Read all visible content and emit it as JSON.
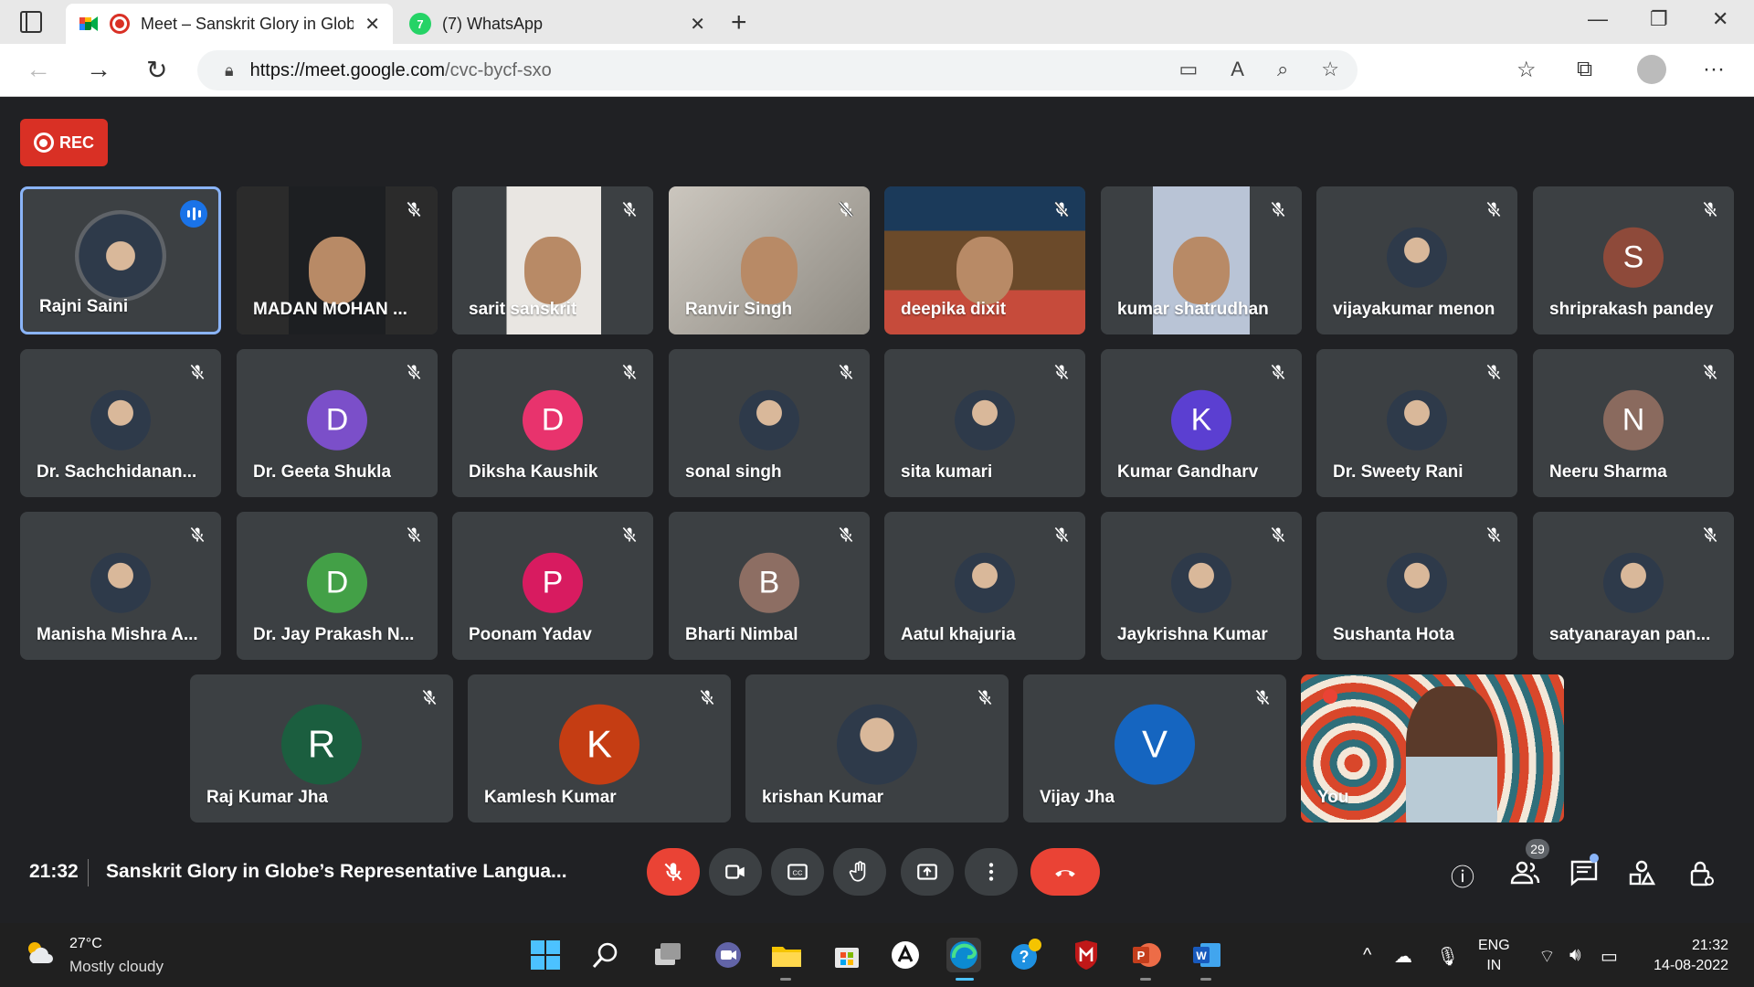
{
  "browser": {
    "tabs": [
      {
        "title": "Meet – Sanskrit Glory in Globe’s Representative Language",
        "active": true
      },
      {
        "title": "(7) WhatsApp",
        "active": false,
        "badge": "7"
      }
    ],
    "url_host": "https://meet.google.com",
    "url_path": "/cvc-bycf-sxo"
  },
  "meet": {
    "rec_label": "REC",
    "time": "21:32",
    "title": "Sanskrit Glory in Globe’s Representative Langua...",
    "participant_count": "29",
    "colors": {
      "bg": "#202124",
      "tile": "#3c4043",
      "red": "#ea4335",
      "speaking_border": "#8ab4f8"
    },
    "participants": [
      {
        "name": "Rajni Saini",
        "kind": "photo",
        "speaking": true
      },
      {
        "name": "MADAN MOHAN ...",
        "kind": "video"
      },
      {
        "name": "sarit sanskrit",
        "kind": "video"
      },
      {
        "name": "Ranvir Singh",
        "kind": "video"
      },
      {
        "name": "deepika dixit",
        "kind": "video"
      },
      {
        "name": "kumar shatrudhan",
        "kind": "video"
      },
      {
        "name": "vijayakumar menon",
        "kind": "photo"
      },
      {
        "name": "shriprakash pandey",
        "kind": "letter",
        "letter": "S",
        "color": "#8e4a3a"
      },
      {
        "name": "Dr. Sachchidanan...",
        "kind": "photo"
      },
      {
        "name": "Dr. Geeta Shukla",
        "kind": "letter",
        "letter": "D",
        "color": "#7b4fc9"
      },
      {
        "name": "Diksha Kaushik",
        "kind": "letter",
        "letter": "D",
        "color": "#e8336d"
      },
      {
        "name": "sonal singh",
        "kind": "photo"
      },
      {
        "name": "sita kumari",
        "kind": "photo"
      },
      {
        "name": "Kumar Gandharv",
        "kind": "letter",
        "letter": "K",
        "color": "#5b3fd1"
      },
      {
        "name": "Dr. Sweety Rani",
        "kind": "photo"
      },
      {
        "name": "Neeru Sharma",
        "kind": "letter",
        "letter": "N",
        "color": "#8a6a5e"
      },
      {
        "name": "Manisha Mishra A...",
        "kind": "photo"
      },
      {
        "name": "Dr. Jay Prakash N...",
        "kind": "letter",
        "letter": "D",
        "color": "#43a047"
      },
      {
        "name": "Poonam Yadav",
        "kind": "letter",
        "letter": "P",
        "color": "#d81b60"
      },
      {
        "name": "Bharti Nimbal",
        "kind": "letter",
        "letter": "B",
        "color": "#8d6e63"
      },
      {
        "name": "Aatul khajuria",
        "kind": "photo"
      },
      {
        "name": "Jaykrishna Kumar",
        "kind": "photo"
      },
      {
        "name": "Sushanta Hota",
        "kind": "photo"
      },
      {
        "name": "satyanarayan pan...",
        "kind": "photo"
      },
      {
        "name": "Raj Kumar Jha",
        "kind": "letter",
        "letter": "R",
        "color": "#1b5e3f"
      },
      {
        "name": "Kamlesh Kumar",
        "kind": "letter",
        "letter": "K",
        "color": "#c53d13"
      },
      {
        "name": "krishan Kumar",
        "kind": "photo"
      },
      {
        "name": "Vijay Jha",
        "kind": "letter",
        "letter": "V",
        "color": "#1565c0"
      },
      {
        "name": "You",
        "kind": "self"
      }
    ]
  },
  "taskbar": {
    "temp": "27°C",
    "condition": "Mostly cloudy",
    "lang1": "ENG",
    "lang2": "IN",
    "time": "21:32",
    "date": "14-08-2022"
  }
}
